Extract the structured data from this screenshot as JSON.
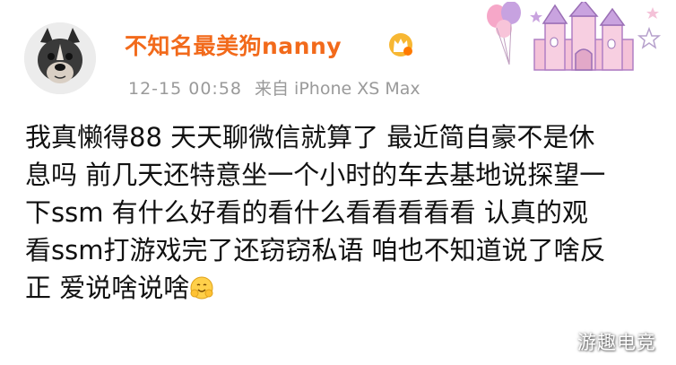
{
  "post": {
    "author": {
      "name": "不知名最美狗nanny",
      "avatar_icon": "french-bulldog-avatar",
      "badge_icon": "crown-vip-icon"
    },
    "meta": {
      "time": "12-15 00:58",
      "source": "来自 iPhone XS Max"
    },
    "decoration_icon": "princess-castle-icon",
    "content_lines": [
      "我真懒得88 天天聊微信就算了 最近简自豪不是休",
      "息吗 前几天还特意坐一个小时的车去基地说探望一",
      "下ssm 有什么好看的看什么看看看看看 认真的观",
      "看ssm打游戏完了还窃窃私语 咱也不知道说了啥反",
      "正 爱说啥说啥"
    ],
    "end_emoji": "hug-emoji"
  },
  "watermark": "游趣电竞",
  "colors": {
    "username": "#f26a1b",
    "meta": "#9a9a9a",
    "text": "#111111",
    "castle_pink": "#f4b7d3",
    "castle_purple": "#c9a3df"
  }
}
